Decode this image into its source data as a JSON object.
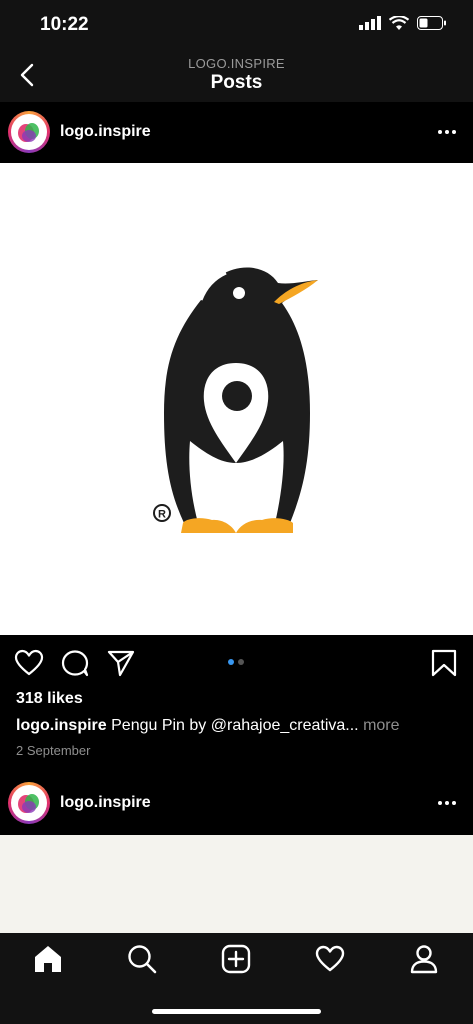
{
  "status": {
    "time": "10:22"
  },
  "header": {
    "subtitle": "LOGO.INSPIRE",
    "title": "Posts"
  },
  "post": {
    "username": "logo.inspire",
    "likes": "318 likes",
    "caption_user": "logo.inspire",
    "caption_text": " Pengu Pin by @rahajoe_creativa...",
    "caption_more": " more",
    "date": "2 September",
    "carousel_count": 2,
    "carousel_active": 0
  },
  "next_post": {
    "username": "logo.inspire"
  },
  "icons": {
    "back": "chevron-left-icon",
    "more": "ellipsis-icon",
    "like": "heart-icon",
    "comment": "comment-icon",
    "share": "send-icon",
    "save": "bookmark-icon",
    "home": "home-icon",
    "search": "search-icon",
    "new_post": "plus-square-icon",
    "activity": "heart-icon",
    "profile": "profile-icon"
  },
  "colors": {
    "accent": "#3897f0",
    "beak": "#f5a623",
    "penguin": "#1d1d1d"
  }
}
